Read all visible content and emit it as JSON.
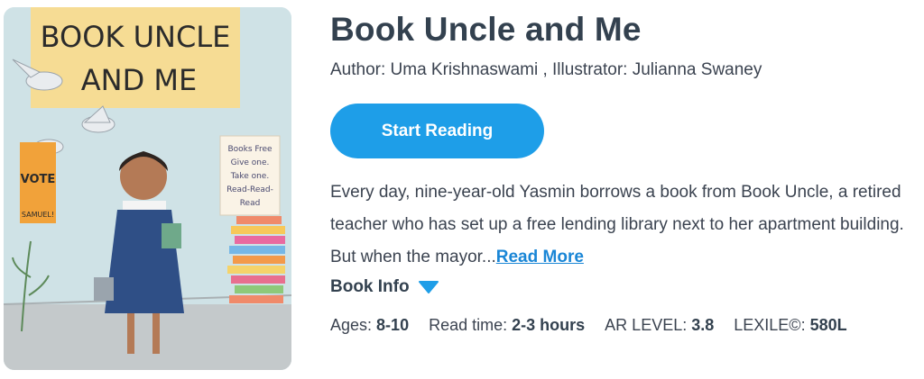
{
  "book": {
    "cover_title_line1": "BOOK UNCLE",
    "cover_title_line2": "AND ME",
    "cover_sign": [
      "Books Free",
      "Give one.",
      "Take one.",
      "Read-Read-",
      "Read"
    ],
    "cover_poster_vote": "VOTE",
    "cover_poster_name": "SAMUEL!",
    "title": "Book Uncle and Me",
    "authors": "Author: Uma Krishnaswami , Illustrator: Julianna Swaney",
    "start_reading_label": "Start Reading",
    "description": "Every day, nine-year-old Yasmin borrows a book from Book Uncle, a retired teacher who has set up a free lending library next to her apartment building. But when the mayor...",
    "read_more_label": "Read More",
    "book_info_label": "Book Info"
  },
  "meta": {
    "ages_label": "Ages:",
    "ages_value": "8-10",
    "read_time_label": "Read time:",
    "read_time_value": "2-3 hours",
    "ar_label": "AR LEVEL:",
    "ar_value": "3.8",
    "lexile_label": "LEXILE©:",
    "lexile_value": "580L"
  },
  "colors": {
    "accent": "#1e9ee8",
    "link": "#1a86d6",
    "title": "#33414f"
  }
}
